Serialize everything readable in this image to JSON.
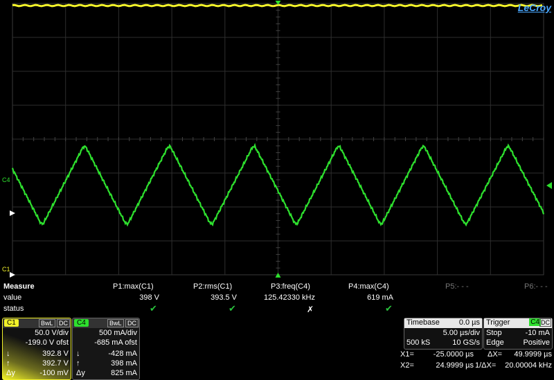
{
  "brand": {
    "logo": "LeCroy"
  },
  "trace_labels": {
    "c4": "C4",
    "c1": "C1"
  },
  "measure": {
    "labels": [
      "Measure",
      "value",
      "status"
    ],
    "params": [
      {
        "name": "P1:max(C1)",
        "value": "398 V",
        "status": "ok"
      },
      {
        "name": "P2:rms(C1)",
        "value": "393.5 V",
        "status": "ok"
      },
      {
        "name": "P3:freq(C4)",
        "value": "125.42330 kHz",
        "status": "warn"
      },
      {
        "name": "P4:max(C4)",
        "value": "619 mA",
        "status": "ok"
      },
      {
        "name": "P5:- - -",
        "value": "",
        "status": ""
      },
      {
        "name": "P6:- - -",
        "value": "",
        "status": ""
      }
    ],
    "ok_glyph": "✔",
    "warn_glyph": "✗"
  },
  "ch1": {
    "tag": "C1",
    "bw": "BwL",
    "cpl": "DC",
    "vdiv": "50.0 V/div",
    "offset": "-199.0 V ofst",
    "down_sym": "↓",
    "down_val": "392.8 V",
    "up_sym": "↑",
    "up_val": "392.7 V",
    "dy_sym": "Δy",
    "dy_val": "-100 mV",
    "color": "#f2f22a"
  },
  "ch4": {
    "tag": "C4",
    "bw": "BwL",
    "cpl": "DC",
    "vdiv": "500 mA/div",
    "offset": "-685 mA ofst",
    "down_sym": "↓",
    "down_val": "-428 mA",
    "up_sym": "↑",
    "up_val": "398 mA",
    "dy_sym": "Δy",
    "dy_val": "825 mA",
    "color": "#2ee02e"
  },
  "timebase": {
    "title": "Timebase",
    "delay": "0.0 µs",
    "tdiv": "5.00 µs/div",
    "samples": "500 kS",
    "rate": "10 GS/s"
  },
  "trigger": {
    "title": "Trigger",
    "src": "C4",
    "cpl": "DC",
    "mode": "Stop",
    "level": "-10 mA",
    "type": "Edge",
    "slope": "Positive"
  },
  "cursors": {
    "x1_label": "X1=",
    "x1": "-25.0000 µs",
    "dx_label": "ΔX=",
    "dx": "49.9999 µs",
    "x2_label": "X2=",
    "x2": "24.9999 µs",
    "inv_label": "1/ΔX=",
    "inv": "20.00004 kHz"
  }
}
